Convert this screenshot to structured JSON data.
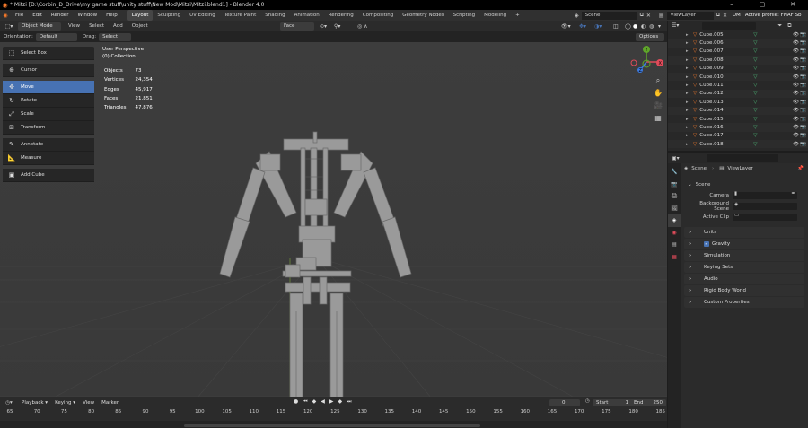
{
  "titlebar": {
    "title": "* Mitzi [D:\\Corbin_D_Drive\\my game stuff\\unity stuff\\New Mod\\Mitzi\\Mitzi.blend1] - Blender 4.0"
  },
  "menu": [
    "File",
    "Edit",
    "Render",
    "Window",
    "Help"
  ],
  "workspace_tabs": [
    "Layout",
    "Sculpting",
    "UV Editing",
    "Texture Paint",
    "Shading",
    "Animation",
    "Rendering",
    "Compositing",
    "Geometry Nodes",
    "Scripting",
    "Modeling"
  ],
  "active_tab": "Layout",
  "topright": {
    "scene": "Scene",
    "view_layer": "ViewLayer",
    "profile": "UMT Active profile: FNAF Sb"
  },
  "viewport_header": {
    "mode": "Object Mode",
    "view": "View",
    "select": "Select",
    "add": "Add",
    "object": "Object",
    "orientation_label": "Orientation:",
    "orientation": "Default",
    "drag_label": "Drag:",
    "drag": "Select Box",
    "face": "Face",
    "options": "Options"
  },
  "tools": [
    "Select Box",
    "Cursor",
    "Move",
    "Rotate",
    "Scale",
    "Transform",
    "Annotate",
    "Measure",
    "Add Cube"
  ],
  "active_tool": "Move",
  "overlay": {
    "view": "User Perspective",
    "collection": "(0) Collection"
  },
  "stats": [
    {
      "label": "Objects",
      "value": "73"
    },
    {
      "label": "Vertices",
      "value": "24,354"
    },
    {
      "label": "Edges",
      "value": "45,917"
    },
    {
      "label": "Faces",
      "value": "21,851"
    },
    {
      "label": "Triangles",
      "value": "47,876"
    }
  ],
  "outliner_items": [
    "Cube.005",
    "Cube.006",
    "Cube.007",
    "Cube.008",
    "Cube.009",
    "Cube.010",
    "Cube.011",
    "Cube.012",
    "Cube.013",
    "Cube.014",
    "Cube.015",
    "Cube.016",
    "Cube.017",
    "Cube.018"
  ],
  "properties": {
    "breadcrumb_scene": "Scene",
    "breadcrumb_layer": "ViewLayer",
    "section": "Scene",
    "camera_label": "Camera",
    "bg_label": "Background Scene",
    "clip_label": "Active Clip",
    "panels": [
      "Units",
      "Gravity",
      "Simulation",
      "Keying Sets",
      "Audio",
      "Rigid Body World",
      "Custom Properties"
    ]
  },
  "timeline": {
    "playback": "Playback",
    "keying": "Keying",
    "view": "View",
    "marker": "Marker",
    "current": "0",
    "start_label": "Start",
    "start": "1",
    "end_label": "End",
    "end": "250",
    "ticks": [
      "65",
      "70",
      "75",
      "80",
      "85",
      "90",
      "95",
      "100",
      "105",
      "110",
      "115",
      "120",
      "125",
      "130",
      "135",
      "140",
      "145",
      "150",
      "155",
      "160",
      "165",
      "170",
      "175",
      "180",
      "185"
    ]
  },
  "colors": {
    "accent": "#4772b3",
    "object_orange": "#f5792a",
    "mesh_green": "#4ec27c"
  }
}
